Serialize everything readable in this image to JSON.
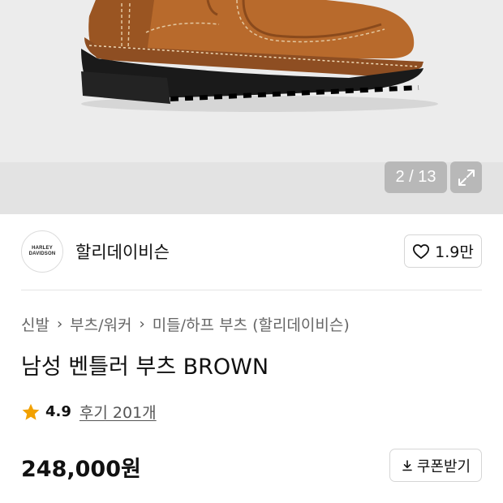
{
  "gallery": {
    "image_subject": "brown leather boot",
    "current_page": "2",
    "total_pages": "13",
    "counter_text": "2 / 13"
  },
  "brand": {
    "logo_text": [
      "HARLEY",
      "DAVIDSON"
    ],
    "name": "할리데이비슨",
    "like_count": "1.9만"
  },
  "breadcrumb": [
    "신발",
    "부츠/워커",
    "미들/하프 부츠 (할리데이비슨)"
  ],
  "product": {
    "title": "남성 벤틀러 부츠 BROWN",
    "rating": "4.9",
    "review_link": "후기 201개",
    "price": "248,000원",
    "coupon_label": "쿠폰받기"
  },
  "colors": {
    "star": "#f2a100",
    "boot_leather": "#b86a2c",
    "sole": "#1a1a1a"
  },
  "icons": [
    "expand-icon",
    "heart-icon",
    "star-icon",
    "download-icon",
    "chevron-right-icon"
  ]
}
